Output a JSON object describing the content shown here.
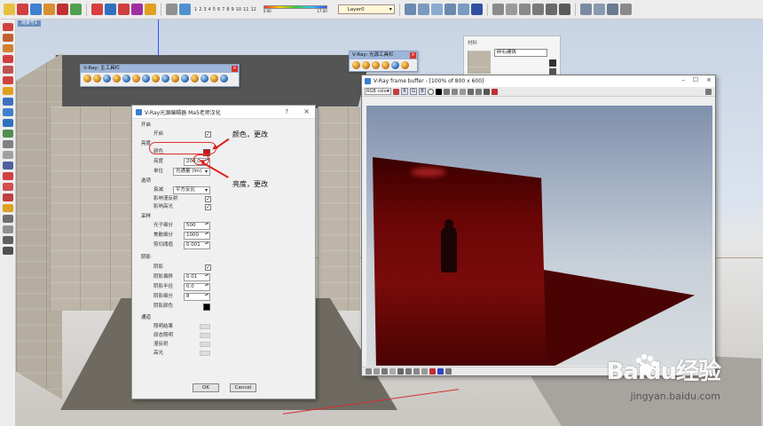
{
  "app": {
    "scene_tab": "场景号1"
  },
  "toolbar": {
    "scale_ticks": [
      "1",
      "2",
      "3",
      "4",
      "5",
      "6",
      "7",
      "8",
      "9",
      "10",
      "11",
      "12"
    ],
    "ramp_min": "0.00",
    "ramp_max": "17.00",
    "layer_value": "Layer0"
  },
  "vray_main_toolbar": {
    "title": "V-Ray: 主工具栏"
  },
  "vray_light_toolbar": {
    "title": "V-Ray: 光源工具栏"
  },
  "material_panel": {
    "header": "材料",
    "name_value": "碎石建筑"
  },
  "light_editor": {
    "title": "V-Ray光源编辑器 Ma5老师汉化",
    "help_icon": "?",
    "close_icon": "×",
    "sections": {
      "enable": "开启",
      "brightness": "亮度",
      "options": "选项",
      "sampling": "采样",
      "shadow": "阴影",
      "channels": "通道"
    },
    "fields": {
      "enable_on": "开启",
      "color": "颜色",
      "intensity": "亮度",
      "intensity_value": "200.0",
      "units": "单位",
      "units_value": "光通量 (lm)",
      "decay": "衰减",
      "decay_value": "平方反比",
      "affect_diffuse": "影响漫反射",
      "affect_specular": "影响高光",
      "photon_subdivs": "光子细分",
      "photon_subdivs_value": "500",
      "caustic_subdivs": "焦散细分",
      "caustic_subdivs_value": "1000",
      "cutoff": "剪切阈值",
      "cutoff_value": "0.001",
      "shadows": "阴影",
      "shadow_bias": "阴影偏移",
      "shadow_bias_value": "0.01",
      "shadow_radius": "阴影半径",
      "shadow_radius_value": "0.0",
      "shadow_subdivs": "阴影细分",
      "shadow_subdivs_value": "8",
      "shadow_color": "阴影颜色",
      "ch_lighting": "照明结果",
      "ch_raw": "原态照明",
      "ch_diffuse": "漫反射",
      "ch_specular": "高光"
    },
    "ok_label": "OK",
    "cancel_label": "Cancel",
    "color_swatch": "#d81010",
    "shadow_swatch": "#000000"
  },
  "annotations": {
    "color_note": "颜色，更改",
    "brightness_note": "亮度，更改"
  },
  "frame_buffer": {
    "title": "V-Ray frame buffer - [100% of 800 x 600]",
    "minimize": "–",
    "maximize": "☐",
    "close": "×",
    "channel_value": "RGB color",
    "rgb": [
      "R",
      "G",
      "B"
    ]
  },
  "watermark": {
    "brand": "Baidu经验",
    "url": "jingyan.baidu.com"
  },
  "colors": {
    "accent_red": "#e02020",
    "panel_title": "#9db5d8"
  }
}
